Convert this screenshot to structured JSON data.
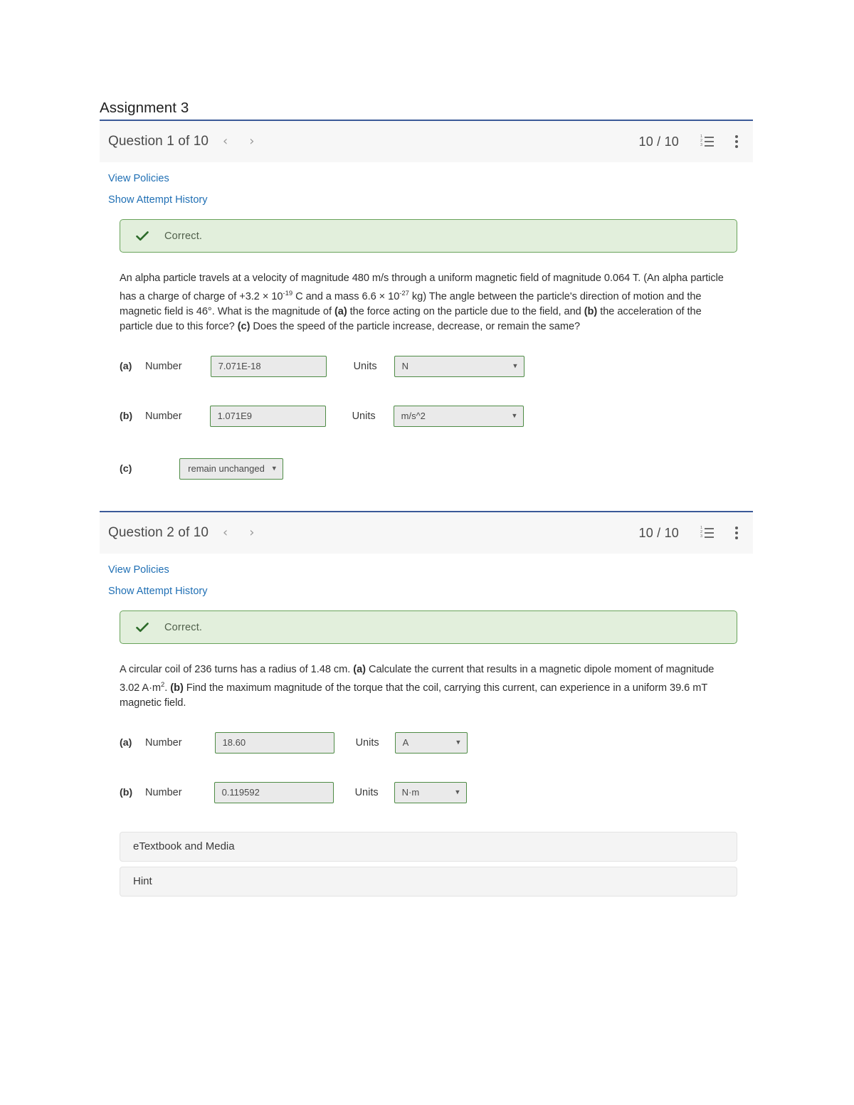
{
  "assignment": {
    "title": "Assignment 3"
  },
  "questions": [
    {
      "header": {
        "title": "Question 1 of 10",
        "prev_arrow": "‹",
        "next_arrow": "›",
        "score": "10 / 10",
        "list_icon_numbers": [
          "1",
          "2",
          "3"
        ]
      },
      "links": {
        "view_policies": "View Policies",
        "show_attempt_history": "Show Attempt History"
      },
      "feedback": {
        "status": "Correct.",
        "icon": "check-icon",
        "bg_color": "#e2efdc",
        "border_color": "#68a35a"
      },
      "prompt_html": "An alpha particle travels at a velocity of magnitude 480 m/s through a uniform magnetic field of magnitude 0.064 T. (An alpha particle has a charge of charge of +3.2 &times; 10<sup>-19</sup> C and a mass 6.6 &times; 10<sup>-27</sup> kg) The angle between the particle's direction of motion and the magnetic field is 46&deg;. What is the magnitude of <b>(a)</b> the force acting on the particle due to the field, and <b>(b)</b> the acceleration of the particle due to this force? <b>(c)</b> Does the speed of the particle increase, decrease, or remain the same?",
      "answers": [
        {
          "label": "(a)",
          "number_word": "Number",
          "number_value": "7.071E-18",
          "units_word": "Units",
          "units_value": "N"
        },
        {
          "label": "(b)",
          "number_word": "Number",
          "number_value": "1.071E9",
          "units_word": "Units",
          "units_value": "m/s^2"
        },
        {
          "label": "(c)",
          "select_value": "remain unchanged"
        }
      ]
    },
    {
      "header": {
        "title": "Question 2 of 10",
        "prev_arrow": "‹",
        "next_arrow": "›",
        "score": "10 / 10",
        "list_icon_numbers": [
          "1",
          "2",
          "3"
        ]
      },
      "links": {
        "view_policies": "View Policies",
        "show_attempt_history": "Show Attempt History"
      },
      "feedback": {
        "status": "Correct.",
        "icon": "check-icon",
        "bg_color": "#e2efdc",
        "border_color": "#68a35a"
      },
      "prompt_html": "A circular coil of 236 turns has a radius of 1.48 cm. <b>(a)</b> Calculate the current that results in a magnetic dipole moment of magnitude 3.02 A&middot;m<sup>2</sup>. <b>(b)</b> Find the maximum magnitude of the torque that the coil, carrying this current, can experience in a uniform 39.6 mT magnetic field.",
      "answers": [
        {
          "label": "(a)",
          "number_word": "Number",
          "number_value": "18.60",
          "units_word": "Units",
          "units_value": "A"
        },
        {
          "label": "(b)",
          "number_word": "Number",
          "number_value": "0.119592",
          "units_word": "Units",
          "units_value": "N·m"
        }
      ],
      "sections": [
        {
          "label": "eTextbook and Media"
        },
        {
          "label": "Hint"
        }
      ]
    }
  ],
  "theme": {
    "card_top_border": "#3b5998",
    "link_color": "#1f6fb4",
    "header_bg": "#f7f7f7",
    "input_border": "#4e8b45",
    "input_bg": "#eaeaea"
  }
}
